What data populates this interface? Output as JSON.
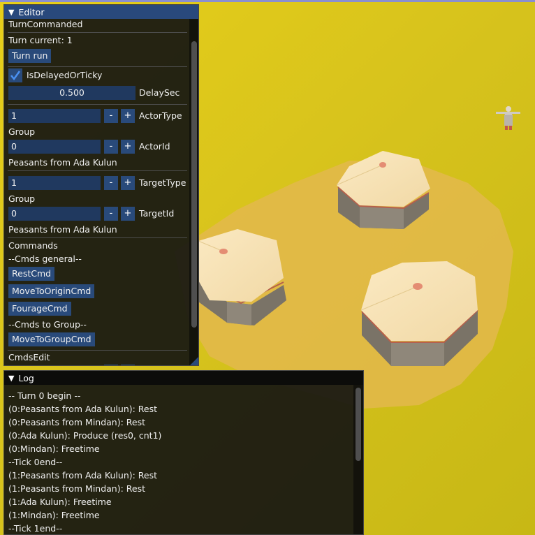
{
  "colors": {
    "ground": "#d4c21b",
    "sand_patch": "#e2b44a",
    "panel_bg": "#18180f",
    "title_active": "#29497c",
    "button": "#294a7a",
    "field": "#20395f"
  },
  "editor": {
    "title": "Editor",
    "turn_commanded": "TurnCommanded",
    "turn_current": "Turn current: 1",
    "turn_run": "Turn run",
    "delayed_label": "IsDelayedOrTicky",
    "delayed_checked": true,
    "delay_value": "0.500",
    "delay_label": "DelaySec",
    "actor_type_value": "1",
    "actor_type_label": "ActorType",
    "actor_group": "Group",
    "actor_id_value": "0",
    "actor_id_label": "ActorId",
    "actor_name": "Peasants from Ada Kulun",
    "target_type_value": "1",
    "target_type_label": "TargetType",
    "target_group": "Group",
    "target_id_value": "0",
    "target_id_label": "TargetId",
    "target_name": "Peasants from Ada Kulun",
    "commands": "Commands",
    "cmds_general": "--Cmds general--",
    "rest_cmd": "RestCmd",
    "move_origin_cmd": "MoveToOriginCmd",
    "fourage_cmd": "FourageCmd",
    "cmds_group": "--Cmds to Group--",
    "move_group_cmd": "MoveToGroupCmd",
    "cmds_edit": "CmdsEdit",
    "minus": "-",
    "plus": "+"
  },
  "log": {
    "title": "Log",
    "lines": [
      "-- Turn 0 begin --",
      "(0:Peasants from Ada Kulun): Rest",
      "(0:Peasants from Mindan): Rest",
      "(0:Ada Kulun): Produce (res0, cnt1)",
      "(0:Mindan): Freetime",
      "--Tick 0end--",
      "(1:Peasants from Ada Kulun): Rest",
      "(1:Peasants from Mindan): Rest",
      "(1:Ada Kulun): Freetime",
      "(1:Mindan): Freetime",
      "--Tick 1end--"
    ]
  }
}
